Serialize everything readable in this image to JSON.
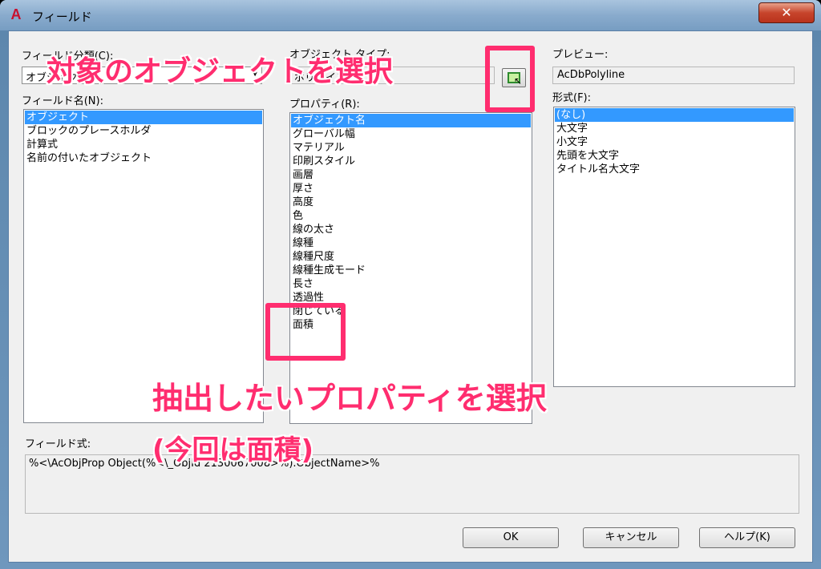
{
  "window": {
    "title": "フィールド",
    "close_label": "✕"
  },
  "field_category": {
    "label": "フィールド分類(C):",
    "value": "オブジェクト"
  },
  "object_type": {
    "label": "オブジェクト タイプ:",
    "value": "ポリライン"
  },
  "preview": {
    "label": "プレビュー:",
    "value": "AcDbPolyline"
  },
  "field_names": {
    "label": "フィールド名(N):",
    "items": [
      "オブジェクト",
      "ブロックのプレースホルダ",
      "計算式",
      "名前の付いたオブジェクト"
    ],
    "selected_index": 0
  },
  "properties": {
    "label": "プロパティ(R):",
    "items": [
      "オブジェクト名",
      "グローバル幅",
      "マテリアル",
      "印刷スタイル",
      "画層",
      "厚さ",
      "高度",
      "色",
      "線の太さ",
      "線種",
      "線種尺度",
      "線種生成モード",
      "長さ",
      "透過性",
      "閉じている",
      "面積"
    ],
    "selected_index": 0
  },
  "format": {
    "label": "形式(F):",
    "items": [
      "(なし)",
      "大文字",
      "小文字",
      "先頭を大文字",
      "タイトル名大文字"
    ],
    "selected_index": 0
  },
  "field_expression": {
    "label": "フィールド式:",
    "value": "%<\\AcObjProp Object(%<\\_ObjId 2130067008>%).ObjectName>%"
  },
  "buttons": {
    "ok": "OK",
    "cancel": "キャンセル",
    "help": "ヘルプ(K)"
  },
  "annotations": {
    "select_object": "対象のオブジェクトを選択",
    "select_property_line1": "抽出したいプロパティを選択",
    "select_property_line2": "(今回は面積)"
  },
  "colors": {
    "annotation": "#ff2d6f",
    "selection": "#3399ff"
  }
}
